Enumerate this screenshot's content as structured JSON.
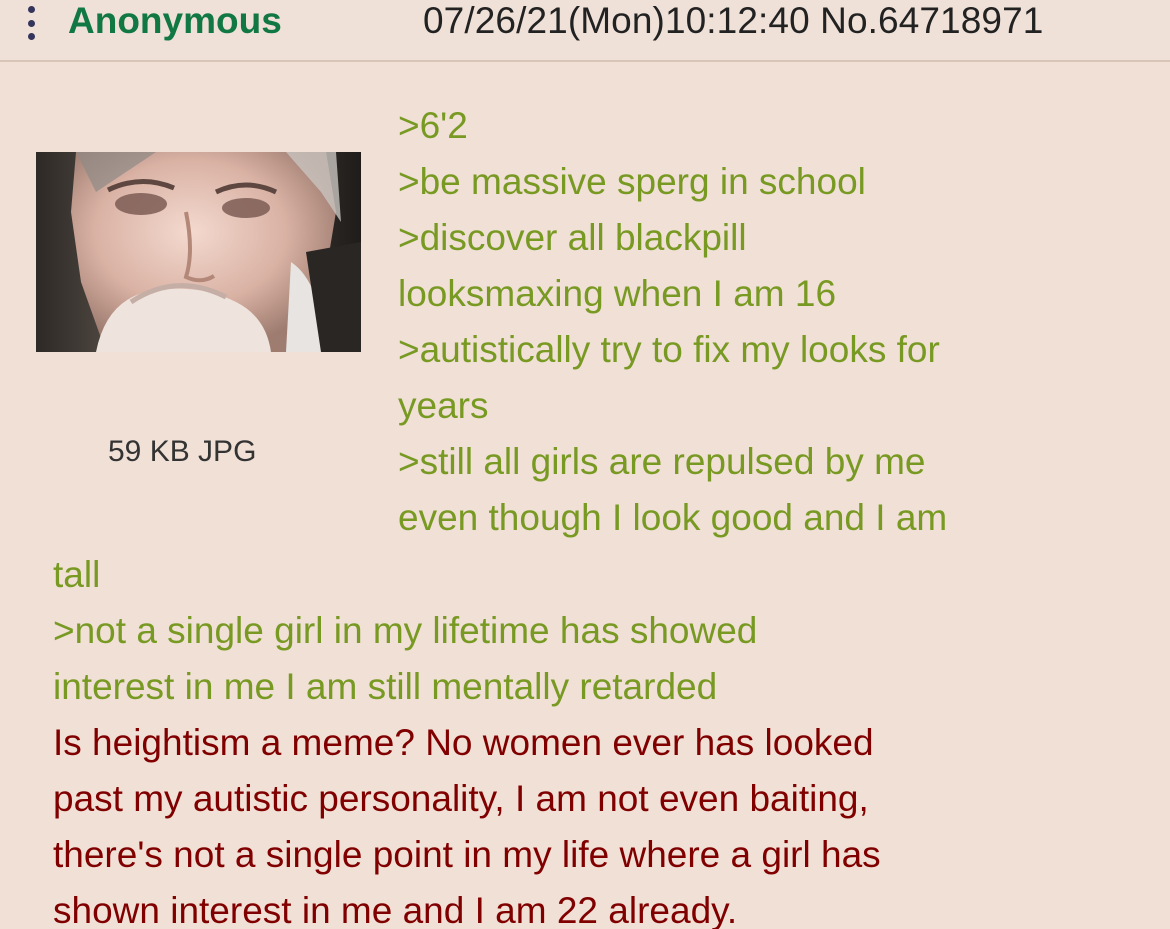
{
  "post": {
    "name": "Anonymous",
    "datetime": "07/26/21(Mon)10:12:40 No.64718971",
    "file_info": "59 KB JPG",
    "lines": [
      ">6'2",
      ">be massive sperg in school",
      ">discover all blackpill",
      "looksmaxing when I am 16",
      ">autistically try to fix my looks for",
      "years",
      ">still all girls are repulsed by me",
      "even though I look good and I am",
      "tall",
      ">not a single girl in my lifetime has showed",
      "interest in me I am still mentally retarded",
      "Is heightism a meme? No women ever has looked",
      "past my autistic personality, I am not even baiting,",
      "there's not a single point in my life where a girl has",
      "shown interest in me and I am 22 already."
    ]
  },
  "icons": {
    "menu": "vertical-dots-icon",
    "thumbnail": "man-thinking-photo"
  },
  "colors": {
    "background": "#f0e0d6",
    "name": "#117743",
    "greentext": "#789922",
    "body_text": "#800000"
  }
}
